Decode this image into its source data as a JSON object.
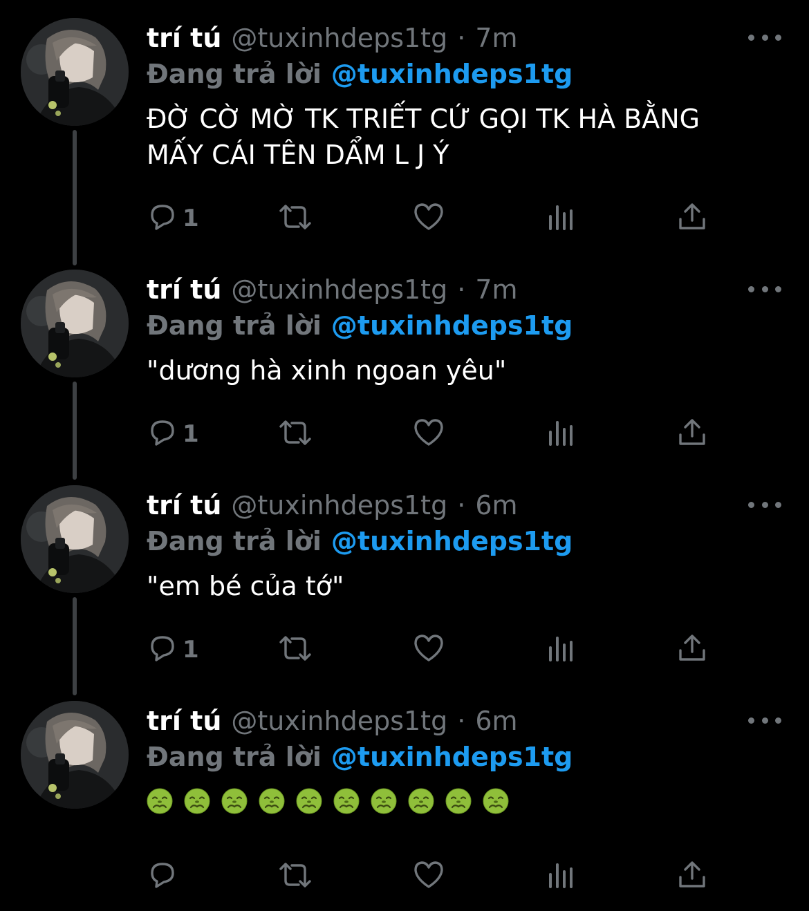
{
  "colors": {
    "background": "#000000",
    "name": "#ffffff",
    "muted": "#71767b",
    "mention": "#1d9bf0",
    "thread_line": "#3d4043"
  },
  "reply_prefix": "Đang trả lời",
  "tweets": [
    {
      "name": "trí tú",
      "handle": "@tuxinhdeps1tg",
      "sep": "·",
      "time": "7m",
      "reply_to": "@tuxinhdeps1tg",
      "text": "ĐỜ CỜ MỜ TK TRIẾT CỨ GỌI TK HÀ BẰNG\nMẤY CÁI TÊN DẨM L J Ý",
      "reply_count": "1"
    },
    {
      "name": "trí tú",
      "handle": "@tuxinhdeps1tg",
      "sep": "·",
      "time": "7m",
      "reply_to": "@tuxinhdeps1tg",
      "text": "\"dương hà xinh ngoan yêu\"",
      "reply_count": "1"
    },
    {
      "name": "trí tú",
      "handle": "@tuxinhdeps1tg",
      "sep": "·",
      "time": "6m",
      "reply_to": "@tuxinhdeps1tg",
      "text": "\"em bé của tớ\"",
      "reply_count": "1"
    },
    {
      "name": "trí tú",
      "handle": "@tuxinhdeps1tg",
      "sep": "·",
      "time": "6m",
      "reply_to": "@tuxinhdeps1tg",
      "emoji_name": "nauseated-face-emoji",
      "emoji_count": 10,
      "reply_count": ""
    }
  ]
}
